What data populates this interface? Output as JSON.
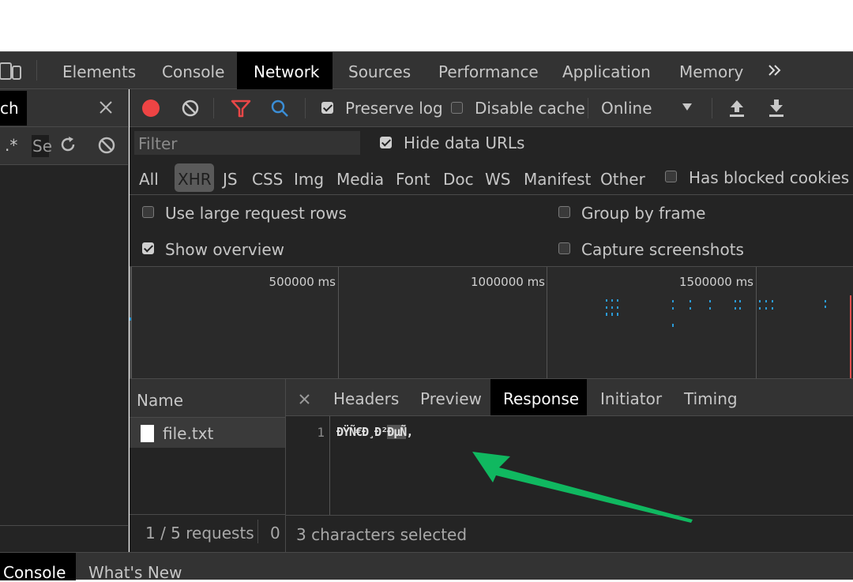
{
  "colors": {
    "panel_bg": "#242424",
    "toolbar_bg": "#333333",
    "record_red": "#ee4444",
    "filter_red": "#e94747",
    "search_blue": "#3b8ed6",
    "arrow_green": "#10b860",
    "waterfall_blue": "#2b9bd8"
  },
  "main_tabs": [
    {
      "label": "Elements"
    },
    {
      "label": "Console"
    },
    {
      "label": "Network",
      "active": true
    },
    {
      "label": "Sources"
    },
    {
      "label": "Performance"
    },
    {
      "label": "Application"
    },
    {
      "label": "Memory"
    }
  ],
  "search_panel": {
    "title_fragment": "ch",
    "regex_label": ".*",
    "input_fragment": "Se"
  },
  "toolbar": {
    "preserve_log": "Preserve log",
    "disable_cache": "Disable cache",
    "throttle": "Online"
  },
  "filter_bar": {
    "placeholder": "Filter",
    "hide_data_urls": "Hide data URLs"
  },
  "type_filters": [
    "All",
    "XHR",
    "JS",
    "CSS",
    "Img",
    "Media",
    "Font",
    "Doc",
    "WS",
    "Manifest",
    "Other"
  ],
  "type_filter_selected": "XHR",
  "has_blocked_cookies": "Has blocked cookies",
  "settings": {
    "large_rows": "Use large request rows",
    "show_overview": "Show overview",
    "group_by_frame": "Group by frame",
    "capture_screenshots": "Capture screenshots"
  },
  "overview": {
    "ticks": [
      "500000 ms",
      "1000000 ms",
      "1500000 ms"
    ]
  },
  "requests": {
    "header": "Name",
    "items": [
      {
        "name": "file.txt"
      }
    ],
    "status": "1 / 5 requests",
    "status_extra": "0"
  },
  "detail": {
    "tabs": [
      "Headers",
      "Preview",
      "Response",
      "Initiator",
      "Timing"
    ],
    "active_tab": "Response",
    "line_number": "1",
    "content_before": "ÐŸÑ€Ð¸Ð²",
    "content_selected": "ÐµÑ",
    "content_after": "‚",
    "status": "3 characters selected"
  },
  "drawer_tabs": [
    "Console",
    "What's New"
  ]
}
